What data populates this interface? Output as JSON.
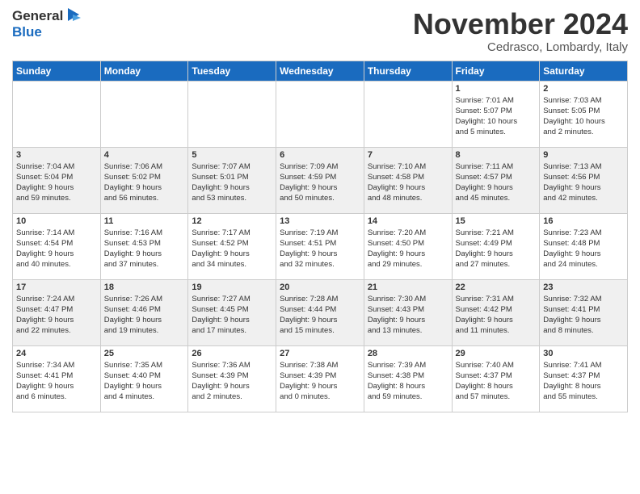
{
  "header": {
    "logo_line1": "General",
    "logo_line2": "Blue",
    "month_title": "November 2024",
    "location": "Cedrasco, Lombardy, Italy"
  },
  "days_of_week": [
    "Sunday",
    "Monday",
    "Tuesday",
    "Wednesday",
    "Thursday",
    "Friday",
    "Saturday"
  ],
  "weeks": [
    [
      {
        "day": "",
        "info": ""
      },
      {
        "day": "",
        "info": ""
      },
      {
        "day": "",
        "info": ""
      },
      {
        "day": "",
        "info": ""
      },
      {
        "day": "",
        "info": ""
      },
      {
        "day": "1",
        "info": "Sunrise: 7:01 AM\nSunset: 5:07 PM\nDaylight: 10 hours\nand 5 minutes."
      },
      {
        "day": "2",
        "info": "Sunrise: 7:03 AM\nSunset: 5:05 PM\nDaylight: 10 hours\nand 2 minutes."
      }
    ],
    [
      {
        "day": "3",
        "info": "Sunrise: 7:04 AM\nSunset: 5:04 PM\nDaylight: 9 hours\nand 59 minutes."
      },
      {
        "day": "4",
        "info": "Sunrise: 7:06 AM\nSunset: 5:02 PM\nDaylight: 9 hours\nand 56 minutes."
      },
      {
        "day": "5",
        "info": "Sunrise: 7:07 AM\nSunset: 5:01 PM\nDaylight: 9 hours\nand 53 minutes."
      },
      {
        "day": "6",
        "info": "Sunrise: 7:09 AM\nSunset: 4:59 PM\nDaylight: 9 hours\nand 50 minutes."
      },
      {
        "day": "7",
        "info": "Sunrise: 7:10 AM\nSunset: 4:58 PM\nDaylight: 9 hours\nand 48 minutes."
      },
      {
        "day": "8",
        "info": "Sunrise: 7:11 AM\nSunset: 4:57 PM\nDaylight: 9 hours\nand 45 minutes."
      },
      {
        "day": "9",
        "info": "Sunrise: 7:13 AM\nSunset: 4:56 PM\nDaylight: 9 hours\nand 42 minutes."
      }
    ],
    [
      {
        "day": "10",
        "info": "Sunrise: 7:14 AM\nSunset: 4:54 PM\nDaylight: 9 hours\nand 40 minutes."
      },
      {
        "day": "11",
        "info": "Sunrise: 7:16 AM\nSunset: 4:53 PM\nDaylight: 9 hours\nand 37 minutes."
      },
      {
        "day": "12",
        "info": "Sunrise: 7:17 AM\nSunset: 4:52 PM\nDaylight: 9 hours\nand 34 minutes."
      },
      {
        "day": "13",
        "info": "Sunrise: 7:19 AM\nSunset: 4:51 PM\nDaylight: 9 hours\nand 32 minutes."
      },
      {
        "day": "14",
        "info": "Sunrise: 7:20 AM\nSunset: 4:50 PM\nDaylight: 9 hours\nand 29 minutes."
      },
      {
        "day": "15",
        "info": "Sunrise: 7:21 AM\nSunset: 4:49 PM\nDaylight: 9 hours\nand 27 minutes."
      },
      {
        "day": "16",
        "info": "Sunrise: 7:23 AM\nSunset: 4:48 PM\nDaylight: 9 hours\nand 24 minutes."
      }
    ],
    [
      {
        "day": "17",
        "info": "Sunrise: 7:24 AM\nSunset: 4:47 PM\nDaylight: 9 hours\nand 22 minutes."
      },
      {
        "day": "18",
        "info": "Sunrise: 7:26 AM\nSunset: 4:46 PM\nDaylight: 9 hours\nand 19 minutes."
      },
      {
        "day": "19",
        "info": "Sunrise: 7:27 AM\nSunset: 4:45 PM\nDaylight: 9 hours\nand 17 minutes."
      },
      {
        "day": "20",
        "info": "Sunrise: 7:28 AM\nSunset: 4:44 PM\nDaylight: 9 hours\nand 15 minutes."
      },
      {
        "day": "21",
        "info": "Sunrise: 7:30 AM\nSunset: 4:43 PM\nDaylight: 9 hours\nand 13 minutes."
      },
      {
        "day": "22",
        "info": "Sunrise: 7:31 AM\nSunset: 4:42 PM\nDaylight: 9 hours\nand 11 minutes."
      },
      {
        "day": "23",
        "info": "Sunrise: 7:32 AM\nSunset: 4:41 PM\nDaylight: 9 hours\nand 8 minutes."
      }
    ],
    [
      {
        "day": "24",
        "info": "Sunrise: 7:34 AM\nSunset: 4:41 PM\nDaylight: 9 hours\nand 6 minutes."
      },
      {
        "day": "25",
        "info": "Sunrise: 7:35 AM\nSunset: 4:40 PM\nDaylight: 9 hours\nand 4 minutes."
      },
      {
        "day": "26",
        "info": "Sunrise: 7:36 AM\nSunset: 4:39 PM\nDaylight: 9 hours\nand 2 minutes."
      },
      {
        "day": "27",
        "info": "Sunrise: 7:38 AM\nSunset: 4:39 PM\nDaylight: 9 hours\nand 0 minutes."
      },
      {
        "day": "28",
        "info": "Sunrise: 7:39 AM\nSunset: 4:38 PM\nDaylight: 8 hours\nand 59 minutes."
      },
      {
        "day": "29",
        "info": "Sunrise: 7:40 AM\nSunset: 4:37 PM\nDaylight: 8 hours\nand 57 minutes."
      },
      {
        "day": "30",
        "info": "Sunrise: 7:41 AM\nSunset: 4:37 PM\nDaylight: 8 hours\nand 55 minutes."
      }
    ]
  ]
}
